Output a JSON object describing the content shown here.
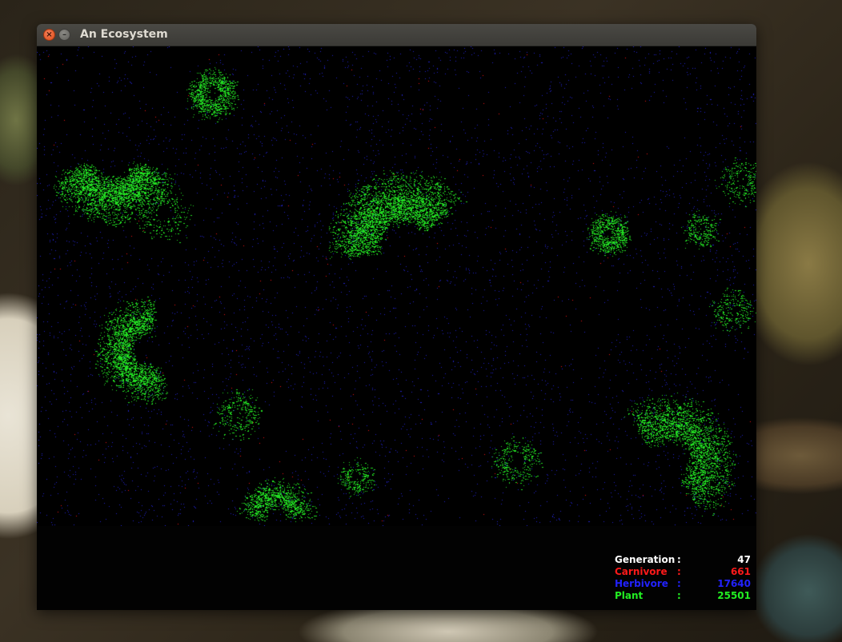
{
  "window": {
    "title": "An Ecosystem",
    "close_glyph": "×",
    "minimize_glyph": "–"
  },
  "simulation": {
    "background_color": "#000000",
    "herbivore_color": "#2020c8",
    "plant_color": "#22dd22",
    "carnivore_color": "#ee1010"
  },
  "stats": {
    "generation": {
      "label": "Generation",
      "colon": ":",
      "value": "47",
      "color": "#ffffff"
    },
    "carnivore": {
      "label": "Carnivore",
      "colon": ":",
      "value": "661",
      "color": "#ff1a1a"
    },
    "herbivore": {
      "label": "Herbivore",
      "colon": ":",
      "value": "17640",
      "color": "#2222ff"
    },
    "plant": {
      "label": "Plant",
      "colon": ":",
      "value": "25501",
      "color": "#22ee22"
    }
  }
}
